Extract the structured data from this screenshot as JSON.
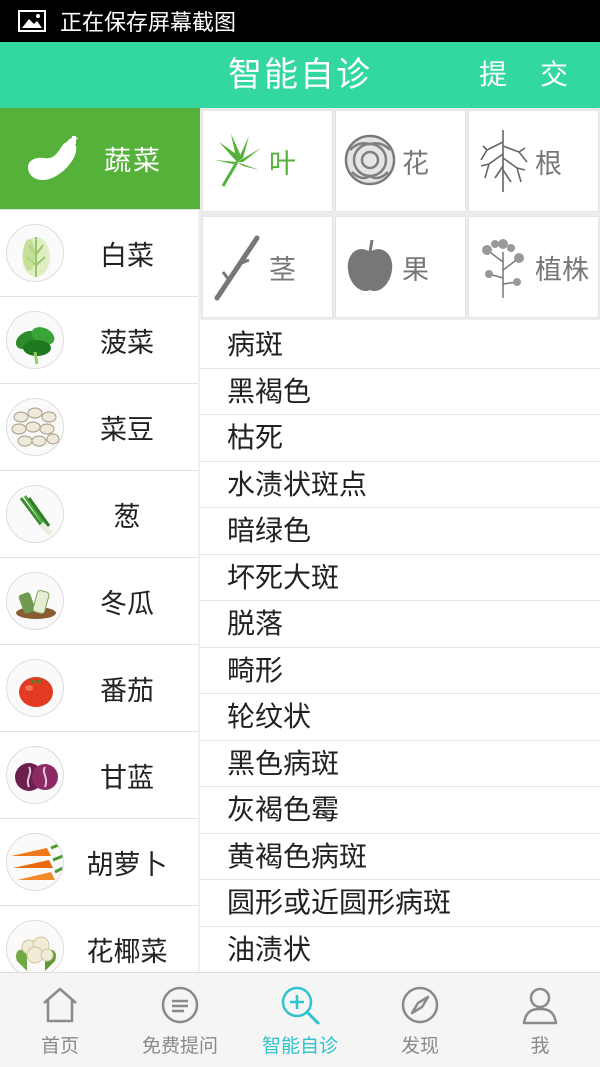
{
  "status_bar": {
    "text": "正在保存屏幕截图",
    "icon": "image-icon"
  },
  "header": {
    "title": "智能自诊",
    "submit_label": "提 交",
    "color": "#33d7a0"
  },
  "category": {
    "label": "蔬菜",
    "icon": "eggplant-icon",
    "color": "#55b13a"
  },
  "vegetables": [
    {
      "label": "白菜",
      "icon": "chinese-cabbage-icon"
    },
    {
      "label": "菠菜",
      "icon": "spinach-icon"
    },
    {
      "label": "菜豆",
      "icon": "bean-icon"
    },
    {
      "label": "葱",
      "icon": "scallion-icon"
    },
    {
      "label": "冬瓜",
      "icon": "winter-melon-icon"
    },
    {
      "label": "番茄",
      "icon": "tomato-icon"
    },
    {
      "label": "甘蓝",
      "icon": "cabbage-icon"
    },
    {
      "label": "胡萝卜",
      "icon": "carrot-icon"
    },
    {
      "label": "花椰菜",
      "icon": "cauliflower-icon"
    }
  ],
  "plant_parts": [
    {
      "label": "叶",
      "icon": "leaf-icon",
      "active": true
    },
    {
      "label": "花",
      "icon": "flower-icon",
      "active": false
    },
    {
      "label": "根",
      "icon": "root-icon",
      "active": false
    },
    {
      "label": "茎",
      "icon": "stem-icon",
      "active": false
    },
    {
      "label": "果",
      "icon": "fruit-icon",
      "active": false
    },
    {
      "label": "植株",
      "icon": "plant-icon",
      "active": false
    }
  ],
  "symptoms": [
    "病斑",
    "黑褐色",
    "枯死",
    "水渍状斑点",
    "暗绿色",
    "坏死大斑",
    "脱落",
    "畸形",
    "轮纹状",
    "黑色病斑",
    "灰褐色霉",
    "黄褐色病斑",
    "圆形或近圆形病斑",
    "油渍状"
  ],
  "tabs": [
    {
      "label": "首页",
      "icon": "home-icon",
      "active": false
    },
    {
      "label": "免费提问",
      "icon": "chat-icon",
      "active": false
    },
    {
      "label": "智能自诊",
      "icon": "diagnose-search-icon",
      "active": true
    },
    {
      "label": "发现",
      "icon": "compass-icon",
      "active": false
    },
    {
      "label": "我",
      "icon": "user-icon",
      "active": false
    }
  ],
  "colors": {
    "accent_teal": "#33d7a0",
    "active_green": "#55b13a",
    "tab_active": "#2fc3cf"
  }
}
